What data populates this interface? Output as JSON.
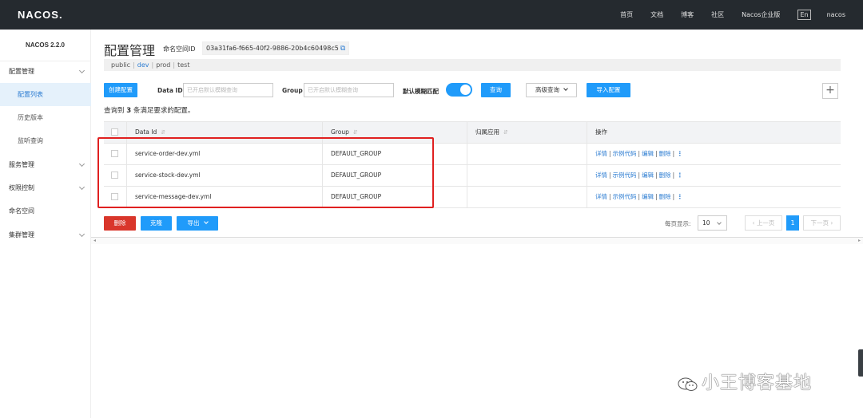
{
  "topbar": {
    "logo": "NACOS.",
    "nav": [
      "首页",
      "文档",
      "博客",
      "社区",
      "Nacos企业版"
    ],
    "lang": "En",
    "user": "nacos"
  },
  "sidebar": {
    "version": "NACOS 2.2.0",
    "items": [
      {
        "label": "配置管理",
        "expandable": true
      },
      {
        "label": "配置列表",
        "active": true
      },
      {
        "label": "历史版本"
      },
      {
        "label": "监听查询"
      },
      {
        "label": "服务管理",
        "expandable": true
      },
      {
        "label": "权限控制",
        "expandable": true
      },
      {
        "label": "命名空间"
      },
      {
        "label": "集群管理",
        "expandable": true
      }
    ]
  },
  "header": {
    "title": "配置管理",
    "namespace_label": "命名空间ID",
    "namespace_id": "03a31fa6-f665-40f2-9886-20b4c60498c5",
    "namespaces": [
      "public",
      "dev",
      "prod",
      "test"
    ],
    "current_namespace": "dev"
  },
  "filters": {
    "create_button": "创建配置",
    "dataid_label": "Data ID",
    "dataid_placeholder": "已开启默认模糊查询",
    "group_label": "Group",
    "group_placeholder": "已开启默认模糊查询",
    "fuzzy_label": "默认模糊匹配",
    "fuzzy_on": true,
    "query_button": "查询",
    "advanced_button": "高级查询",
    "import_button": "导入配置",
    "add_icon": "+"
  },
  "summary": {
    "prefix": "查询到",
    "count": "3",
    "suffix": "条满足要求的配置。"
  },
  "table": {
    "headers": [
      "Data Id",
      "Group",
      "归属应用",
      "操作"
    ],
    "rows": [
      {
        "data_id": "service-order-dev.yml",
        "group": "DEFAULT_GROUP",
        "app": ""
      },
      {
        "data_id": "service-stock-dev.yml",
        "group": "DEFAULT_GROUP",
        "app": ""
      },
      {
        "data_id": "service-message-dev.yml",
        "group": "DEFAULT_GROUP",
        "app": ""
      }
    ],
    "ops": [
      "详情",
      "示例代码",
      "编辑",
      "删除"
    ],
    "more_icon": "⋮"
  },
  "bulk": {
    "delete_button": "删除",
    "clone_button": "克隆",
    "export_button": "导出"
  },
  "pagination": {
    "page_size_label": "每页显示:",
    "page_size": "10",
    "prev": "上一页",
    "current_page": "1",
    "next": "下一页"
  },
  "watermark": {
    "text": "小王博客基地"
  },
  "colors": {
    "primary": "#209bfa",
    "danger": "#d9362b",
    "topbar": "#252a2f",
    "highlight": "#e02020"
  }
}
